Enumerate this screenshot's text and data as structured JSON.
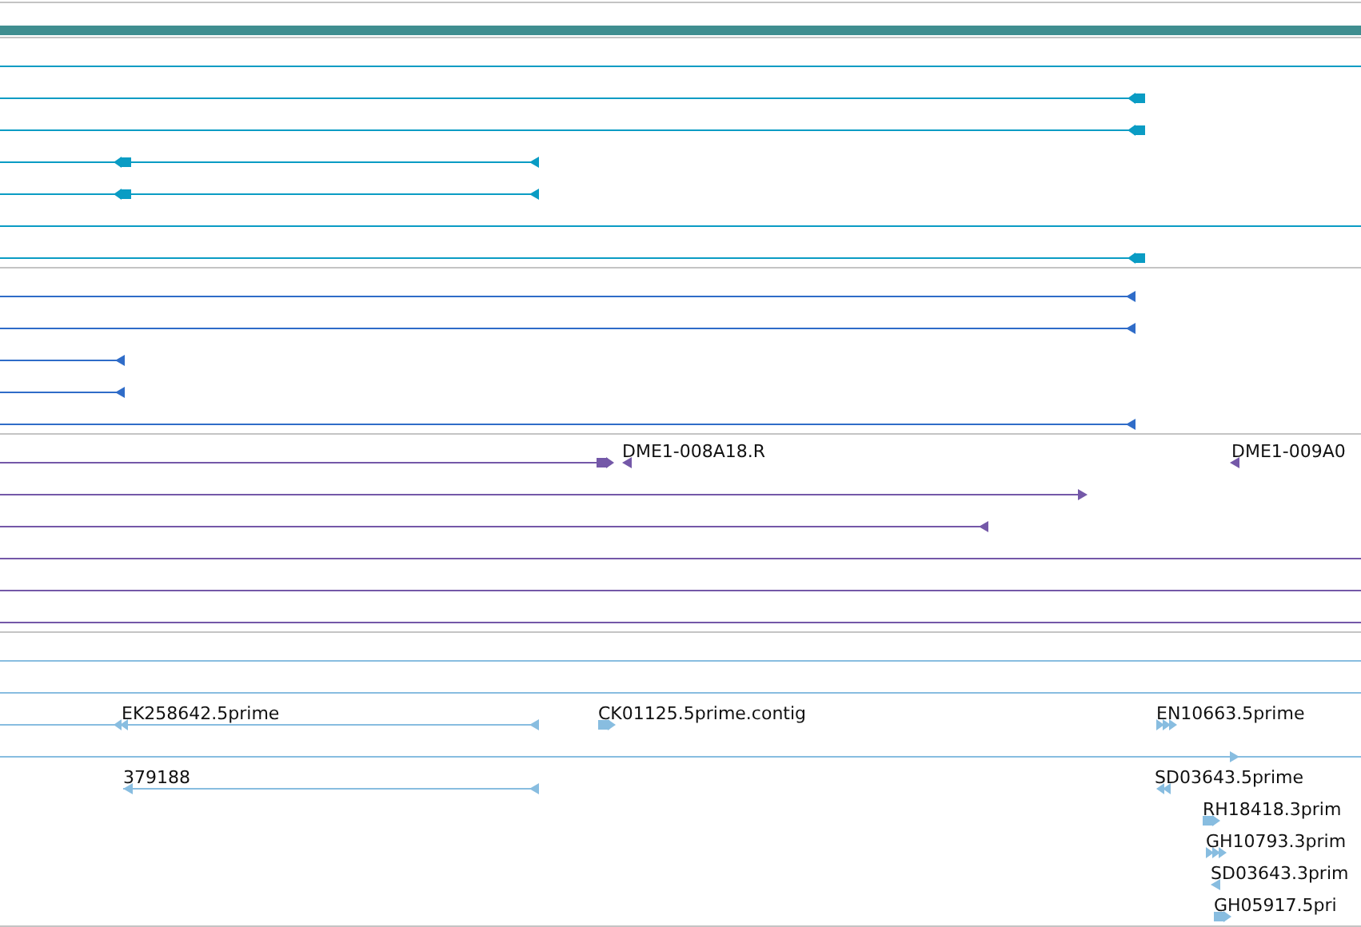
{
  "tracks": [
    {
      "color": "#0a9cc4",
      "rows": [
        {
          "kind": "full"
        },
        {
          "kind": "segment",
          "glyphs": [
            {
              "kind": "block-left"
            }
          ]
        },
        {
          "kind": "segment",
          "glyphs": [
            {
              "kind": "block-left"
            }
          ]
        },
        {
          "kind": "segment",
          "glyphs": [
            {
              "kind": "block-left"
            },
            {
              "kind": "arrow-left"
            }
          ]
        },
        {
          "kind": "segment",
          "glyphs": [
            {
              "kind": "block-left"
            },
            {
              "kind": "arrow-left"
            }
          ]
        },
        {
          "kind": "full"
        },
        {
          "kind": "segment",
          "glyphs": [
            {
              "kind": "block-left"
            }
          ]
        }
      ]
    },
    {
      "color": "#2f6cc8",
      "rows": [
        {
          "kind": "segment",
          "glyphs": [
            {
              "kind": "arrow-left"
            }
          ]
        },
        {
          "kind": "segment",
          "glyphs": [
            {
              "kind": "arrow-left"
            }
          ]
        },
        {
          "kind": "segment",
          "glyphs": [
            {
              "kind": "arrow-left"
            }
          ]
        },
        {
          "kind": "segment",
          "glyphs": [
            {
              "kind": "arrow-left"
            }
          ]
        },
        {
          "kind": "segment",
          "glyphs": [
            {
              "kind": "arrow-left"
            }
          ]
        }
      ]
    },
    {
      "color": "#7458a8",
      "rows": [
        {
          "kind": "segment",
          "glyphs": [
            {
              "kind": "block-right"
            },
            {
              "kind": "arrow-left"
            },
            {
              "kind": "arrow-left"
            }
          ],
          "labels": [
            "DME1-008A18.R",
            "DME1-009A0"
          ]
        },
        {
          "kind": "segment",
          "glyphs": [
            {
              "kind": "arrow-right"
            }
          ]
        },
        {
          "kind": "segment",
          "glyphs": [
            {
              "kind": "arrow-left"
            }
          ]
        },
        {
          "kind": "full"
        },
        {
          "kind": "full"
        },
        {
          "kind": "full"
        }
      ]
    },
    {
      "color": "#88bde0",
      "rows": [
        {
          "kind": "full"
        },
        {
          "kind": "full"
        },
        {
          "kind": "segment",
          "glyphs": [
            {
              "kind": "double-left"
            },
            {
              "kind": "arrow-left"
            },
            {
              "kind": "block-right"
            },
            {
              "kind": "triple-right"
            }
          ],
          "labels": [
            "EK258642.5prime",
            "CK01125.5prime.contig",
            "EN10663.5prime"
          ]
        },
        {
          "kind": "full",
          "glyphs": [
            {
              "kind": "arrow-right"
            }
          ]
        },
        {
          "kind": "segment",
          "glyphs": [
            {
              "kind": "arrow-left"
            },
            {
              "kind": "arrow-left"
            },
            {
              "kind": "double-left"
            }
          ],
          "labels": [
            "379188",
            "SD03643.5prime"
          ]
        },
        {
          "kind": "none",
          "glyphs": [
            {
              "kind": "block-right"
            }
          ],
          "labels": [
            "RH18418.3prim"
          ]
        },
        {
          "kind": "none",
          "glyphs": [
            {
              "kind": "triple-right"
            }
          ],
          "labels": [
            "GH10793.3prim"
          ]
        },
        {
          "kind": "none",
          "glyphs": [
            {
              "kind": "arrow-left"
            }
          ],
          "labels": [
            "SD03643.3prim"
          ]
        },
        {
          "kind": "none",
          "glyphs": [
            {
              "kind": "block-right"
            }
          ],
          "labels": [
            "GH05917.5pri"
          ]
        }
      ]
    }
  ]
}
